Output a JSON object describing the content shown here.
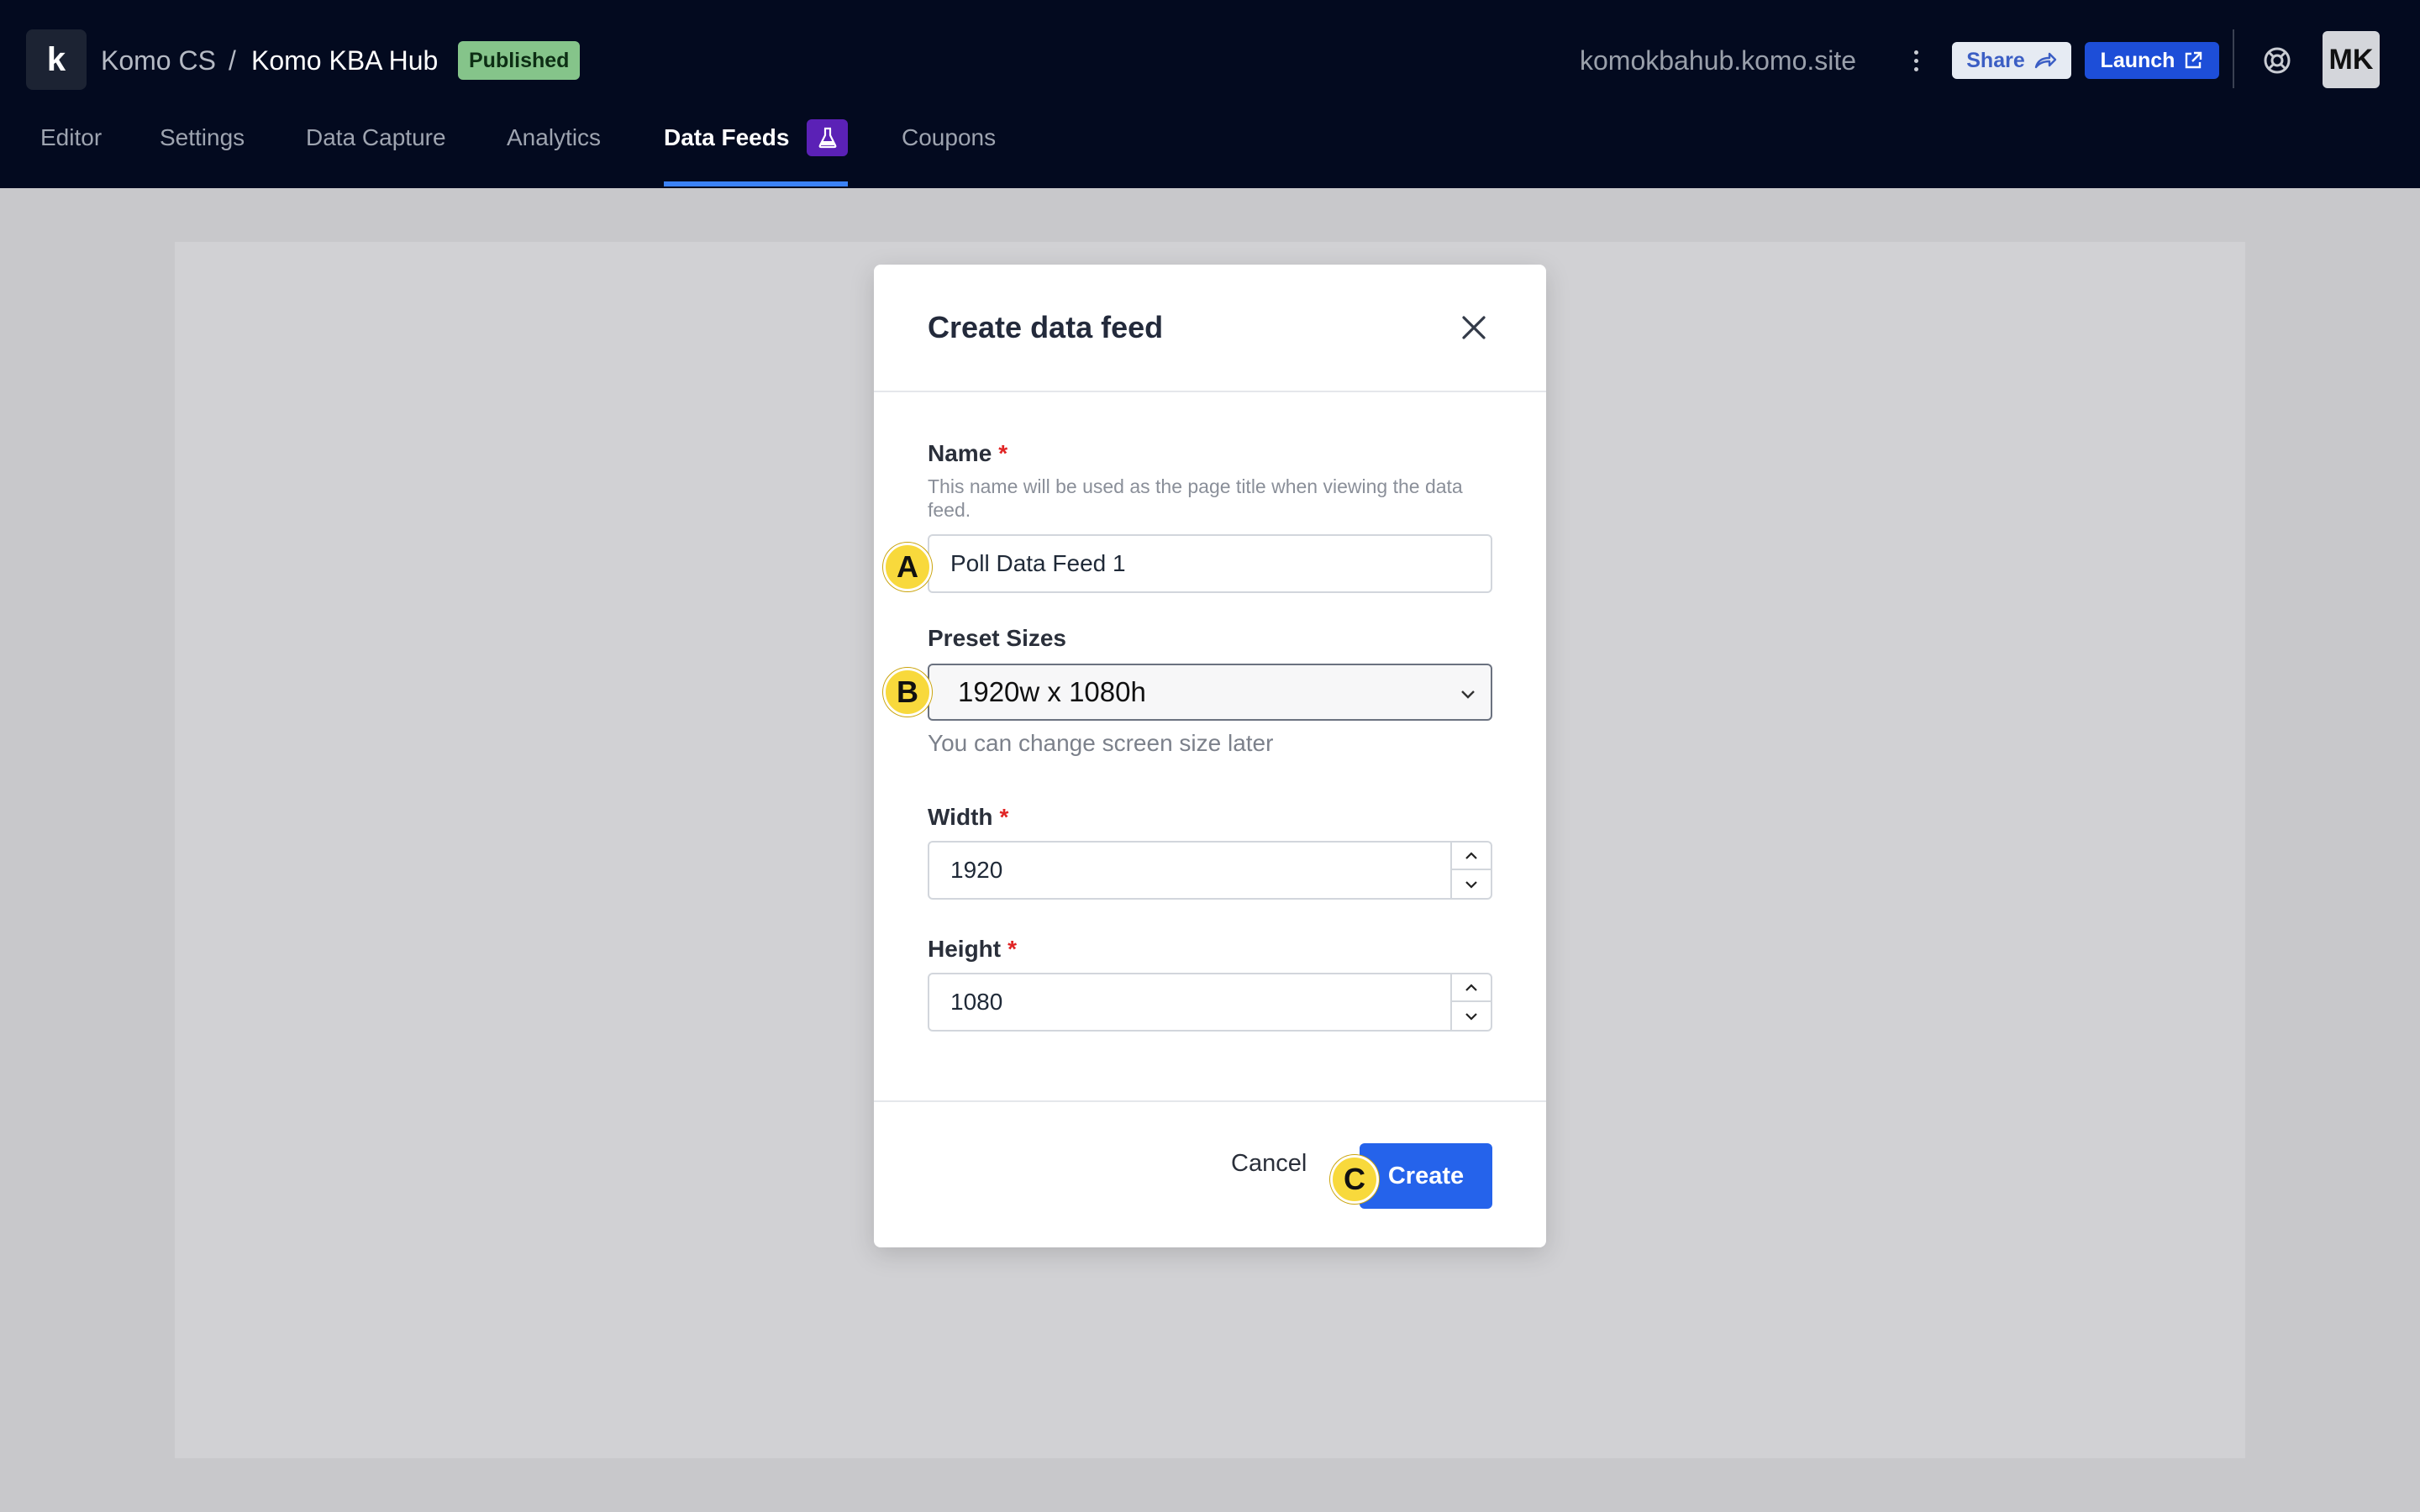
{
  "header": {
    "logo_letter": "k",
    "org": "Komo CS",
    "separator": "/",
    "hub": "Komo KBA Hub",
    "status_badge": "Published",
    "domain": "komokbahub.komo.site",
    "share_label": "Share",
    "launch_label": "Launch",
    "avatar_initials": "MK"
  },
  "tabs": [
    {
      "label": "Editor",
      "active": false
    },
    {
      "label": "Settings",
      "active": false
    },
    {
      "label": "Data Capture",
      "active": false
    },
    {
      "label": "Analytics",
      "active": false
    },
    {
      "label": "Data Feeds",
      "active": true
    },
    {
      "label": "Coupons",
      "active": false
    }
  ],
  "modal": {
    "title": "Create data feed",
    "name_label": "Name",
    "required_mark": "*",
    "name_hint": "This name will be used as the page title when viewing the data feed.",
    "name_value": "Poll Data Feed 1",
    "preset_label": "Preset Sizes",
    "preset_value": "1920w x 1080h",
    "preset_hint": "You can change screen size later",
    "width_label": "Width",
    "width_value": "1920",
    "height_label": "Height",
    "height_value": "1080",
    "cancel_label": "Cancel",
    "create_label": "Create"
  },
  "markers": [
    "A",
    "B",
    "C"
  ],
  "colors": {
    "header_bg": "#030a1f",
    "accent": "#2563eb",
    "published_badge": "#85c48a",
    "beta_badge": "#5b21b6",
    "marker": "#f8d93c"
  }
}
